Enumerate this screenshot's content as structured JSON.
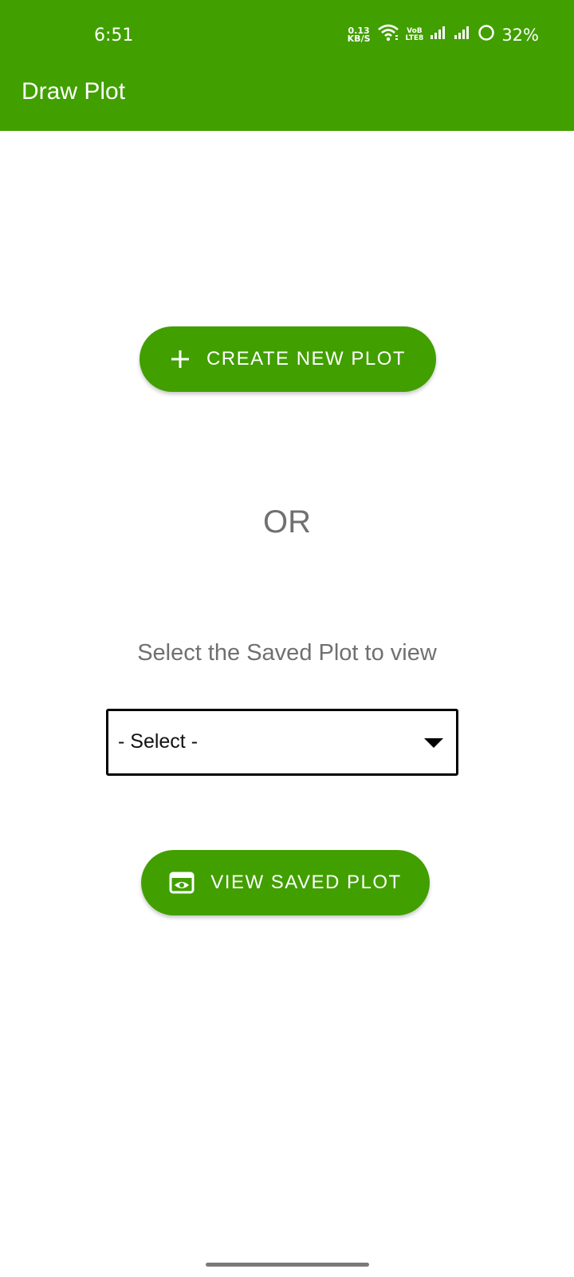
{
  "status_bar": {
    "time": "6:51",
    "net_speed_value": "0.13",
    "net_speed_unit": "KB/S",
    "volte_top": "VoB",
    "volte_bottom": "LTE8",
    "battery": "32%"
  },
  "app_bar": {
    "title": "Draw Plot"
  },
  "main": {
    "create_button_label": "CREATE NEW PLOT",
    "or_text": "OR",
    "select_label": "Select the Saved Plot to view",
    "dropdown_selected": "- Select -",
    "view_button_label": "VIEW SAVED PLOT"
  },
  "icons": {
    "create": "plus-icon",
    "view": "eye-icon",
    "dropdown": "dropdown-arrow-icon"
  },
  "colors": {
    "primary": "#419f00",
    "on_primary": "#ffffff",
    "secondary_text": "#707070"
  }
}
